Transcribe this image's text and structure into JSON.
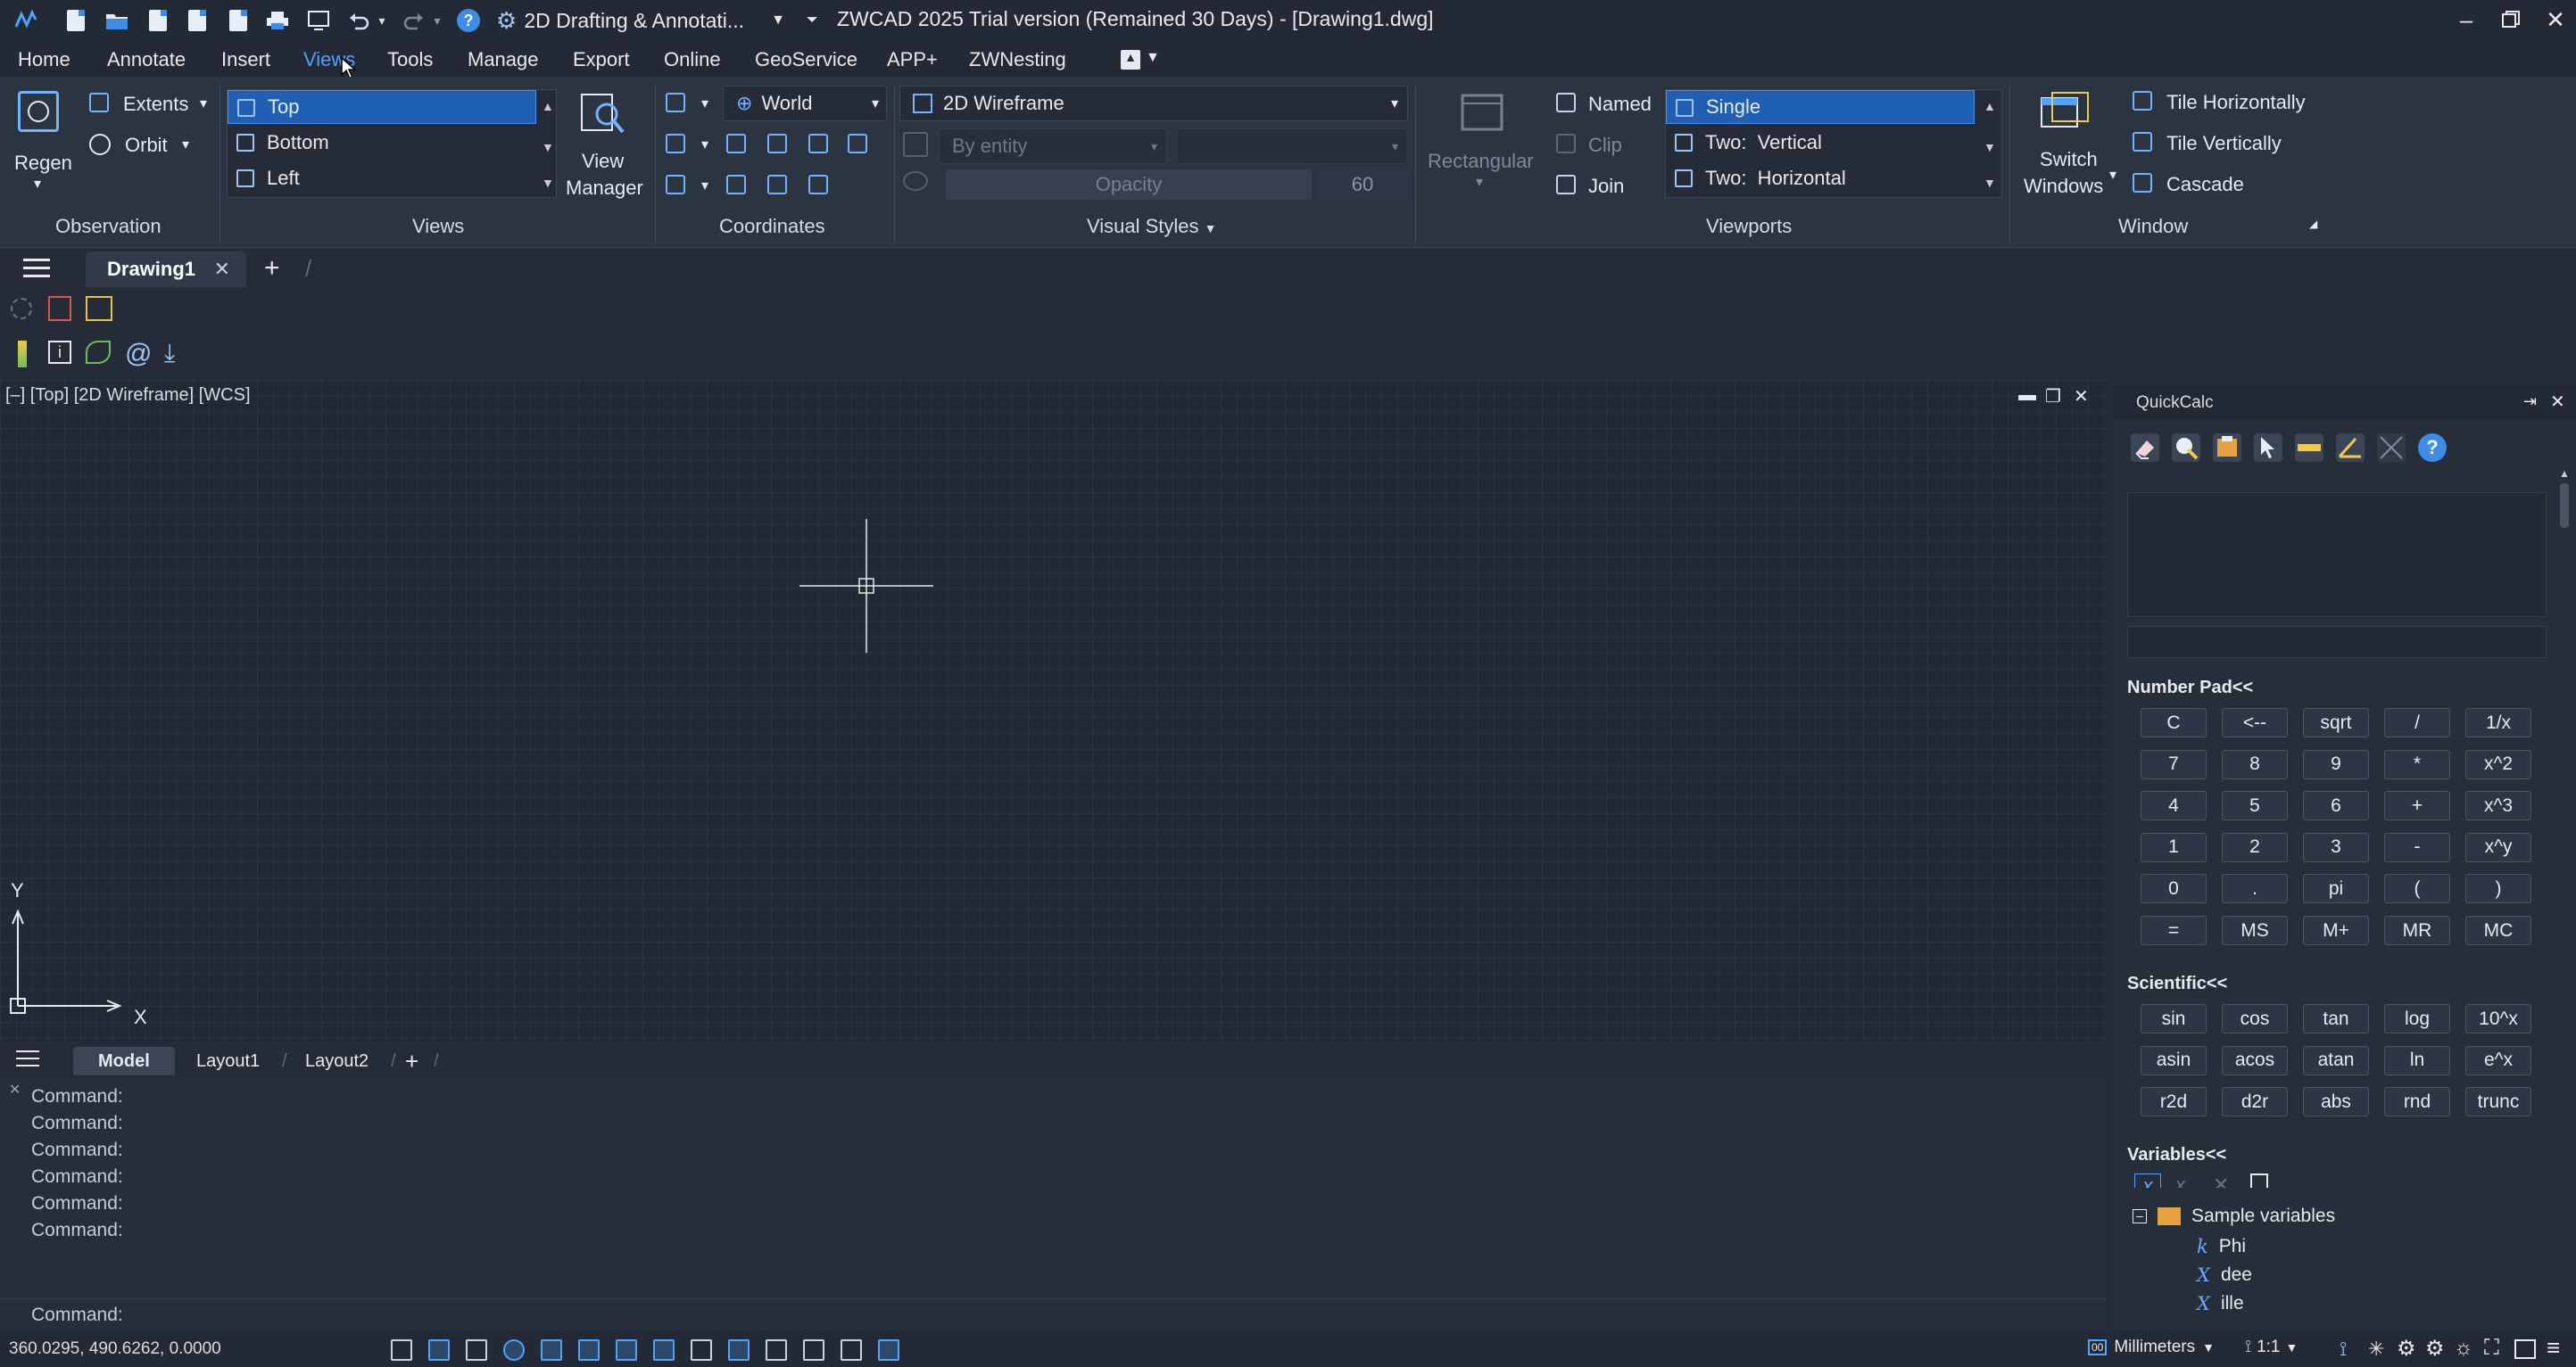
{
  "titlebar": {
    "workspace": "2D Drafting & Annotati...",
    "app_title": "ZWCAD 2025 Trial version (Remained 30 Days) - [Drawing1.dwg]",
    "help": "?"
  },
  "menu": [
    "Home",
    "Annotate",
    "Insert",
    "Views",
    "Tools",
    "Manage",
    "Export",
    "Online",
    "GeoService",
    "APP+",
    "ZWNesting"
  ],
  "ribbon": {
    "observation": {
      "regen": "Regen",
      "extents": "Extents",
      "orbit": "Orbit",
      "label": "Observation"
    },
    "views": {
      "items": [
        "Top",
        "Bottom",
        "Left"
      ],
      "selected": "Top",
      "manager_line1": "View",
      "manager_line2": "Manager",
      "label": "Views"
    },
    "coordinates": {
      "ucs": "World",
      "label": "Coordinates"
    },
    "visual_styles": {
      "style": "2D Wireframe",
      "by_entity": "By entity",
      "opacity_label": "Opacity",
      "opacity_value": "60",
      "label": "Visual Styles"
    },
    "viewports": {
      "rectangular": "Rectangular",
      "named": "Named",
      "clip": "Clip",
      "join": "Join",
      "list": [
        "Single",
        "Two:  Vertical",
        "Two:  Horizontal"
      ],
      "selected": "Single",
      "label": "Viewports"
    },
    "window": {
      "switch_line1": "Switch",
      "switch_line2": "Windows",
      "tile_horizontally": "Tile Horizontally",
      "tile_vertically": "Tile Vertically",
      "cascade": "Cascade",
      "label": "Window"
    }
  },
  "doc_tab": "Drawing1",
  "viewport_label": "[–] [Top] [2D Wireframe] [WCS]",
  "axis": {
    "x": "X",
    "y": "Y"
  },
  "layout_tabs": [
    "Model",
    "Layout1",
    "Layout2"
  ],
  "command_history": [
    "Command:",
    "Command:",
    "Command:",
    "Command:",
    "Command:",
    "Command:"
  ],
  "command_prompt": "Command:",
  "status": {
    "coords": "360.0295, 490.6262, 0.0000",
    "units": "Millimeters",
    "scale": "1:1"
  },
  "quickcalc": {
    "title": "QuickCalc",
    "number_pad_label": "Number Pad<<",
    "number_pad": [
      [
        "C",
        "<--",
        "sqrt",
        "/",
        "1/x"
      ],
      [
        "7",
        "8",
        "9",
        "*",
        "x^2"
      ],
      [
        "4",
        "5",
        "6",
        "+",
        "x^3"
      ],
      [
        "1",
        "2",
        "3",
        "-",
        "x^y"
      ],
      [
        "0",
        ".",
        "pi",
        "(",
        ")"
      ],
      [
        "=",
        "MS",
        "M+",
        "MR",
        "MC"
      ]
    ],
    "scientific_label": "Scientific<<",
    "scientific": [
      [
        "sin",
        "cos",
        "tan",
        "log",
        "10^x"
      ],
      [
        "asin",
        "acos",
        "atan",
        "ln",
        "e^x"
      ],
      [
        "r2d",
        "d2r",
        "abs",
        "rnd",
        "trunc"
      ]
    ],
    "variables_label": "Variables<<",
    "variables": {
      "folder": "Sample variables",
      "items": [
        {
          "type": "k",
          "name": "Phi"
        },
        {
          "type": "X",
          "name": "dee"
        },
        {
          "type": "X",
          "name": "ille"
        }
      ]
    }
  },
  "colors": {
    "accent": "#1f5fb4",
    "icon_blue": "#4fa3ff",
    "panel_bg": "#2b3441"
  }
}
